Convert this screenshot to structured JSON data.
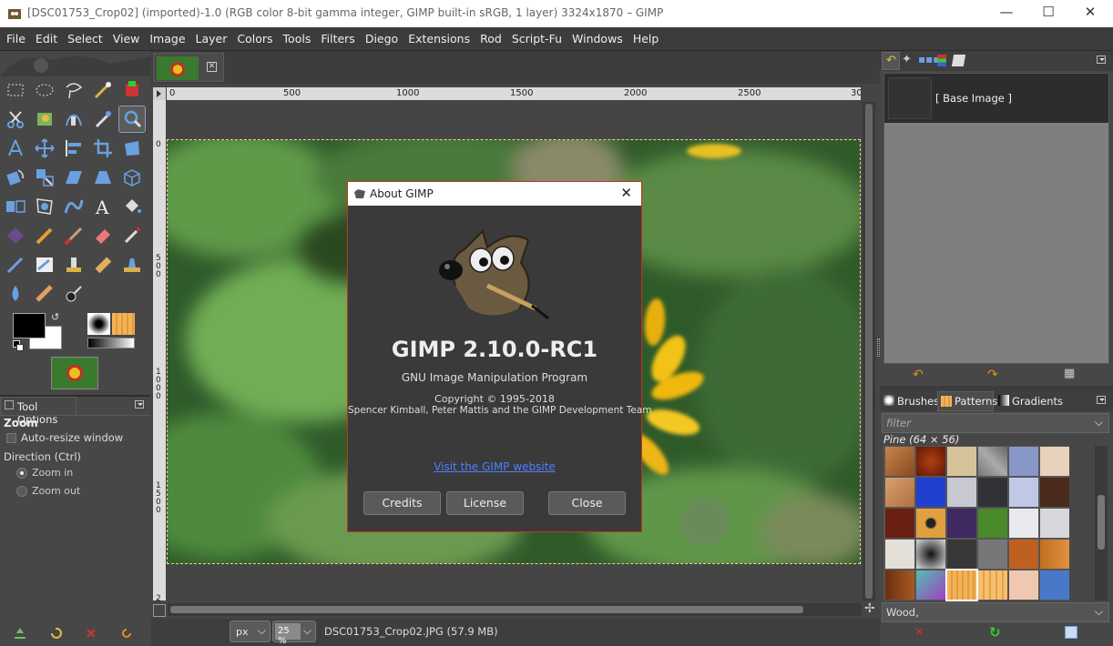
{
  "window": {
    "title": "[DSC01753_Crop02] (imported)-1.0 (RGB color 8-bit gamma integer, GIMP built-in sRGB, 1 layer) 3324x1870 – GIMP",
    "minimize": "—",
    "maximize": "☐",
    "close": "✕"
  },
  "menu": [
    "File",
    "Edit",
    "Select",
    "View",
    "Image",
    "Layer",
    "Colors",
    "Tools",
    "Filters",
    "Diego",
    "Extensions",
    "Rod",
    "Script-Fu",
    "Windows",
    "Help"
  ],
  "ruler": {
    "h_ticks": [
      "0",
      "500",
      "1000",
      "1500",
      "2000",
      "2500",
      "30"
    ],
    "v_ticks": [
      "0",
      "5\n0\n0",
      "1\n0\n0\n0",
      "1\n5\n0\n0",
      "2"
    ]
  },
  "tool_options": {
    "tab": "Tool Options",
    "tool": "Zoom",
    "auto_resize": "Auto-resize window",
    "direction_label": "Direction  (Ctrl)",
    "zoom_in": "Zoom in",
    "zoom_out": "Zoom out"
  },
  "about": {
    "title": "About GIMP",
    "name": "GIMP 2.10.0-RC1",
    "subtitle": "GNU Image Manipulation Program",
    "copyright": "Copyright © 1995-2018",
    "authors": "Spencer Kimball, Peter Mattis and the GIMP Development Team",
    "link": "Visit the GIMP website",
    "credits": "Credits",
    "license": "License",
    "close": "Close"
  },
  "layers": {
    "item": "[ Base Image ]"
  },
  "patterns": {
    "tabs": [
      "Brushes",
      "Patterns",
      "Gradients"
    ],
    "filter_placeholder": "filter",
    "selected": "Pine (64 × 56)",
    "tag_value": "Wood,"
  },
  "status": {
    "unit": "px",
    "zoom": "25 %",
    "file": "DSC01753_Crop02.JPG (57.9 MB)"
  },
  "colors": {
    "accent": "#c2351d",
    "link": "#4d7fff"
  }
}
